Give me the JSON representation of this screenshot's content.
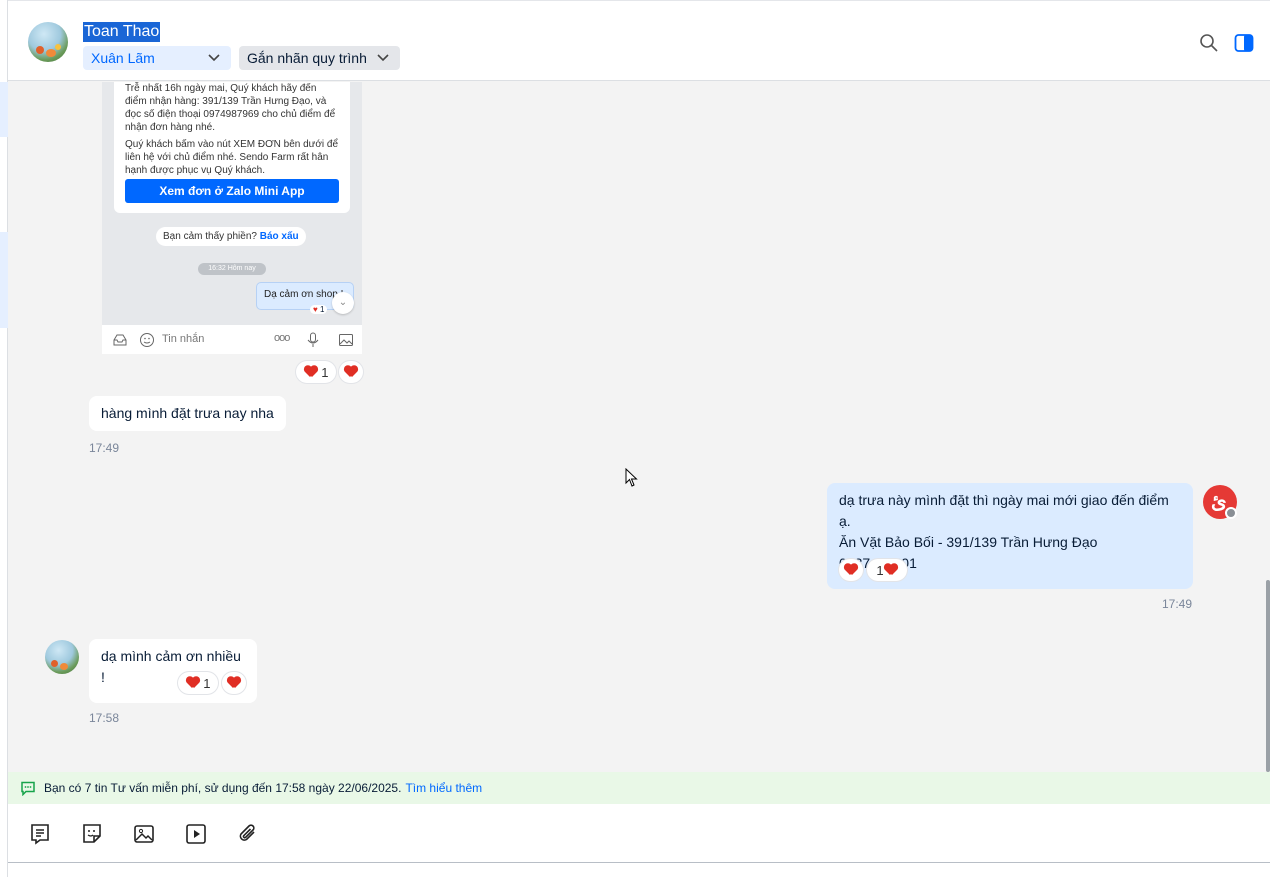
{
  "contact": {
    "name": "Toan Thao",
    "assigned": "Xuân Lãm",
    "tag_label": "Gắn nhãn quy trình"
  },
  "screenshot": {
    "card_text_1": "Trễ nhất 16h ngày mai, Quý khách hãy đến điểm nhận hàng: 391/139 Trần Hưng Đạo, và đọc số điện thoại 0974987969 cho chủ điểm để nhận đơn hàng nhé.",
    "card_text_2": "Quý khách bấm vào nút XEM ĐƠN bên dưới để liên hệ với chủ điểm nhé. Sendo Farm rất hân hạnh được phục vụ Quý khách.",
    "button": "Xem đơn ở Zalo Mini App",
    "feedback_prompt": "Bạn cảm thấy phiền?",
    "feedback_link": "Báo xấu",
    "time": "16:32 Hôm nay",
    "my_message": "Dạ cảm ơn shop !",
    "mini_react_count": "1",
    "input_placeholder": "Tin nhắn"
  },
  "messages": [
    {
      "side": "in",
      "text": "",
      "react_count": "1"
    },
    {
      "side": "in",
      "text": "hàng mình đặt trưa nay nha",
      "time": "17:49"
    },
    {
      "side": "out",
      "line1": "dạ trưa này mình đặt thì ngày mai mới giao đến điểm ạ.",
      "line2": "Ăn Vặt Bảo Bối - 391/139 Trần Hưng Đạo",
      "line3": "0937464401",
      "react_count": "1",
      "time": "17:49"
    },
    {
      "side": "in",
      "text": "dạ mình cảm ơn nhiều !",
      "react_count": "1",
      "time": "17:58"
    }
  ],
  "notice": {
    "text": "Bạn có 7 tin Tư vấn miễn phí, sử dụng đến 17:58 ngày 22/06/2025.",
    "link": "Tìm hiểu thêm"
  },
  "toolbar": [
    "quick-message-icon",
    "sticker-icon",
    "image-icon",
    "video-icon",
    "attach-icon"
  ],
  "colors": {
    "accent": "#0068ff",
    "my_bubble": "#dbebff",
    "notice_bg": "#e9f8e7",
    "heart": "#e02e24"
  }
}
